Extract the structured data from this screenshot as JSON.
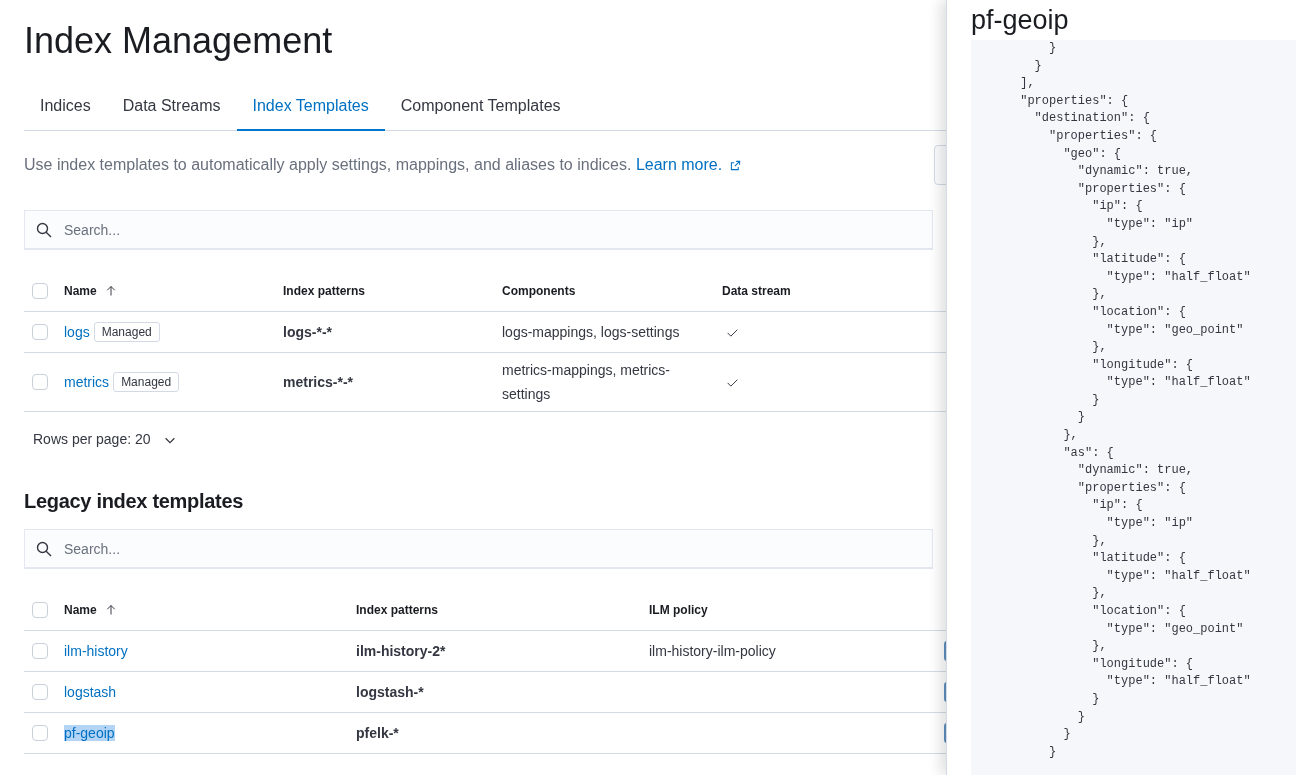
{
  "page": {
    "title": "Index Management"
  },
  "tabs": [
    {
      "label": "Indices",
      "selected": false
    },
    {
      "label": "Data Streams",
      "selected": false
    },
    {
      "label": "Index Templates",
      "selected": true
    },
    {
      "label": "Component Templates",
      "selected": false
    }
  ],
  "description": {
    "text": "Use index templates to automatically apply settings, mappings, and aliases to indices.",
    "link": "Learn more."
  },
  "templates": {
    "search": {
      "placeholder": "Search..."
    },
    "columns": [
      "Name",
      "Index patterns",
      "Components",
      "Data stream"
    ],
    "select_all_checked": false,
    "rows": [
      {
        "name": "logs",
        "badge": "Managed",
        "index_patterns": "logs-*-*",
        "components": "logs-mappings, logs-settings",
        "data_stream": true,
        "checked": false
      },
      {
        "name": "metrics",
        "badge": "Managed",
        "index_patterns": "metrics-*-*",
        "components": "metrics-mappings, metrics-settings",
        "data_stream": true,
        "checked": false
      }
    ],
    "rows_per_page": "Rows per page: 20"
  },
  "legacy": {
    "title": "Legacy index templates",
    "search": {
      "placeholder": "Search..."
    },
    "columns": [
      "Name",
      "Index patterns",
      "ILM policy"
    ],
    "select_all_checked": false,
    "rows": [
      {
        "name": "ilm-history",
        "index_patterns": "ilm-history-2*",
        "ilm_policy": "ilm-history-ilm-policy",
        "checked": false,
        "highlighted": false
      },
      {
        "name": "logstash",
        "index_patterns": "logstash-*",
        "checked": false,
        "highlighted": false
      },
      {
        "name": "pf-geoip",
        "index_patterns": "pfelk-*",
        "checked": false,
        "highlighted": true
      }
    ]
  },
  "flyout": {
    "title": "pf-geoip",
    "code_lines": [
      "          }",
      "        }",
      "      ],",
      "      \"properties\": {",
      "        \"destination\": {",
      "          \"properties\": {",
      "            \"geo\": {",
      "              \"dynamic\": true,",
      "              \"properties\": {",
      "                \"ip\": {",
      "                  \"type\": \"ip\"",
      "                },",
      "                \"latitude\": {",
      "                  \"type\": \"half_float\"",
      "                },",
      "                \"location\": {",
      "                  \"type\": \"geo_point\"",
      "                },",
      "                \"longitude\": {",
      "                  \"type\": \"half_float\"",
      "                }",
      "              }",
      "            },",
      "            \"as\": {",
      "              \"dynamic\": true,",
      "              \"properties\": {",
      "                \"ip\": {",
      "                  \"type\": \"ip\"",
      "                },",
      "                \"latitude\": {",
      "                  \"type\": \"half_float\"",
      "                },",
      "                \"location\": {",
      "                  \"type\": \"geo_point\"",
      "                },",
      "                \"longitude\": {",
      "                  \"type\": \"half_float\"",
      "                }",
      "              }",
      "            }",
      "          }"
    ]
  }
}
